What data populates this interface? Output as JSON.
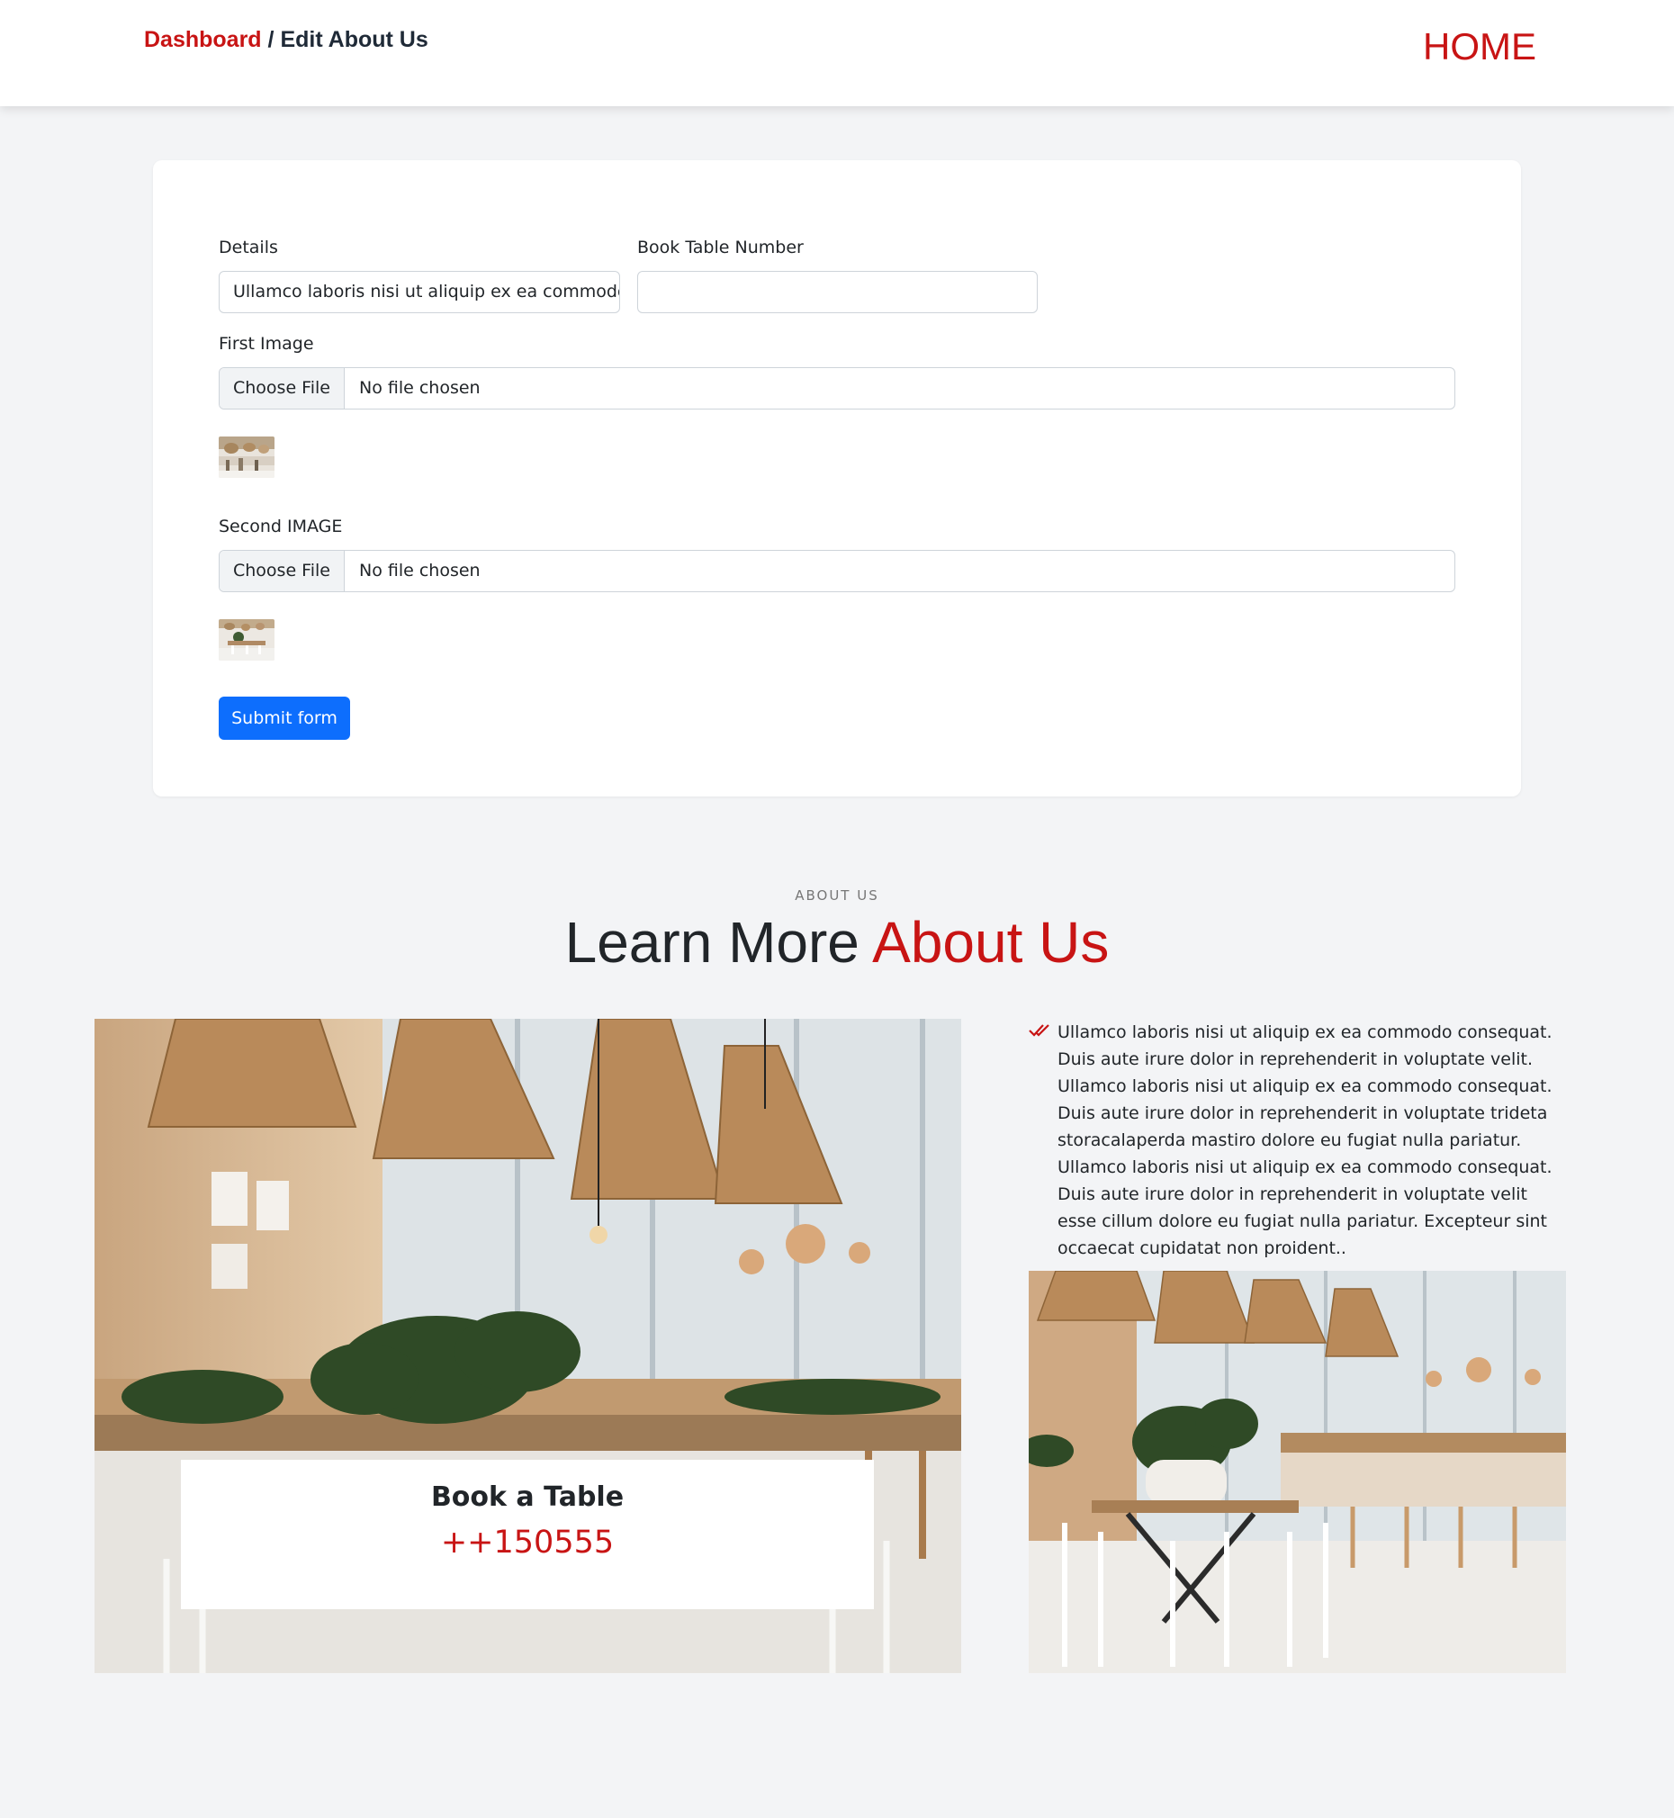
{
  "header": {
    "breadcrumb_link": "Dashboard",
    "breadcrumb_separator": " / ",
    "breadcrumb_current": "Edit About Us",
    "home_label": "HOME"
  },
  "form": {
    "details_label": "Details",
    "details_value": "Ullamco laboris nisi ut aliquip ex ea commodo",
    "book_table_label": "Book Table Number",
    "book_table_value": "",
    "first_image_label": "First Image",
    "second_image_label": "Second IMAGE",
    "choose_file_label": "Choose File",
    "no_file_label": "No file chosen",
    "submit_label": "Submit form"
  },
  "about": {
    "subtitle": "ABOUT US",
    "title_part1": "Learn More ",
    "title_part2": "About Us",
    "book_title": "Book a Table",
    "book_phone": "++150555",
    "text": "Ullamco laboris nisi ut aliquip ex ea commodo consequat. Duis aute irure dolor in reprehenderit in voluptate velit. Ullamco laboris nisi ut aliquip ex ea commodo consequat. Duis aute irure dolor in reprehenderit in voluptate trideta storacalaperda mastiro dolore eu fugiat nulla pariatur. Ullamco laboris nisi ut aliquip ex ea commodo consequat. Duis aute irure dolor in reprehenderit in voluptate velit esse cillum dolore eu fugiat nulla pariatur. Excepteur sint occaecat cupidatat non proident.."
  },
  "colors": {
    "accent": "#c81414",
    "primary_button": "#0d6efd",
    "page_background": "#f3f4f6"
  }
}
